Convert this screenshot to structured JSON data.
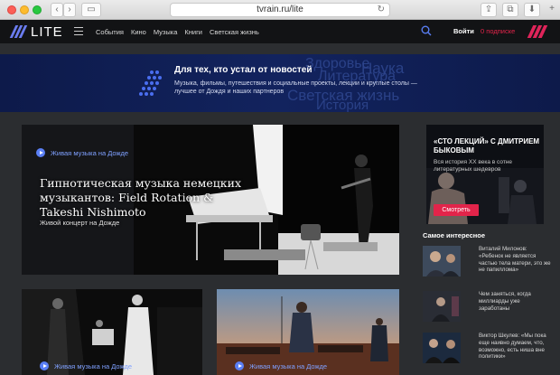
{
  "browser": {
    "url": "tvrain.ru/lite"
  },
  "nav": {
    "logo_text": "LITE",
    "links": [
      "События",
      "Кино",
      "Музыка",
      "Книги",
      "Светская жизнь"
    ],
    "login_label": "Войти",
    "subscribe_label": "0 подписке",
    "accent": "#e2244a"
  },
  "banner": {
    "title": "Для тех, кто устал от новостей",
    "description": "Музыка, фильмы, путешествия и социальные проекты, лекции и круглые столы — лучшее от Дождя и наших партнеров",
    "background_words": [
      "Здоровье",
      "Наука",
      "Литература",
      "Светская жизнь",
      "История"
    ]
  },
  "hero": {
    "tag": "Живая музыка на Дожде",
    "title": "Гипнотическая музыка немецких музыкантов: Field Rotation & Takeshi Nishimoto",
    "subtitle": "Живой концерт на Дожде"
  },
  "promo": {
    "title": "«СТО ЛЕКЦИЙ» С ДМИТРИЕМ БЫКОВЫМ",
    "description": "Вся история XX века в сотне литературных шедевров",
    "button_label": "Смотреть"
  },
  "sidebar": {
    "section_title": "Самое интересное",
    "items": [
      {
        "text": "Виталий Милонов: «Ребенок не является частью тела матери, это же не папиллома»"
      },
      {
        "text": "Чем заняться, когда миллиарды уже заработаны"
      },
      {
        "text": "Виктор Шкулев: «Мы пока еще наивно думаем, что, возможно, есть ниша вне политики»"
      }
    ]
  },
  "cards": [
    {
      "tag": "Живая музыка на Дожде"
    },
    {
      "tag": "Живая музыка на Дожде"
    }
  ]
}
